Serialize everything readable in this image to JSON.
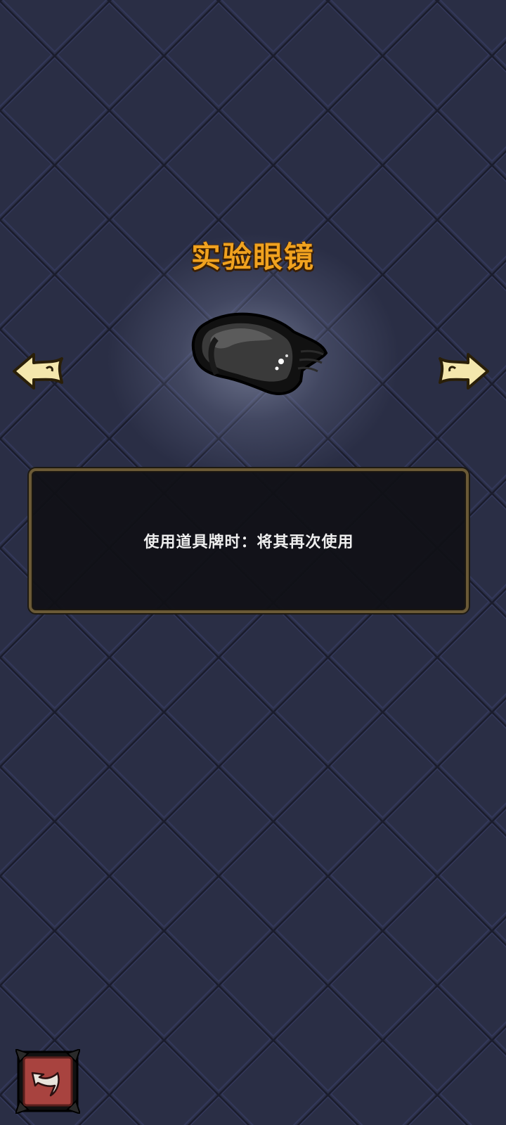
{
  "item": {
    "name": "实验眼镜",
    "image": "safety-goggles",
    "description": "使用道具牌时：将其再次使用"
  },
  "navigation": {
    "prev_icon": "arrow-left-icon",
    "next_icon": "arrow-right-icon",
    "back_icon": "return-arrow-icon"
  },
  "colors": {
    "background": "#262a40",
    "title": "#f0a21f",
    "panel_border": "#6b5a36",
    "arrow_fill": "#f4e7ad",
    "back_button": "#a8433f"
  }
}
